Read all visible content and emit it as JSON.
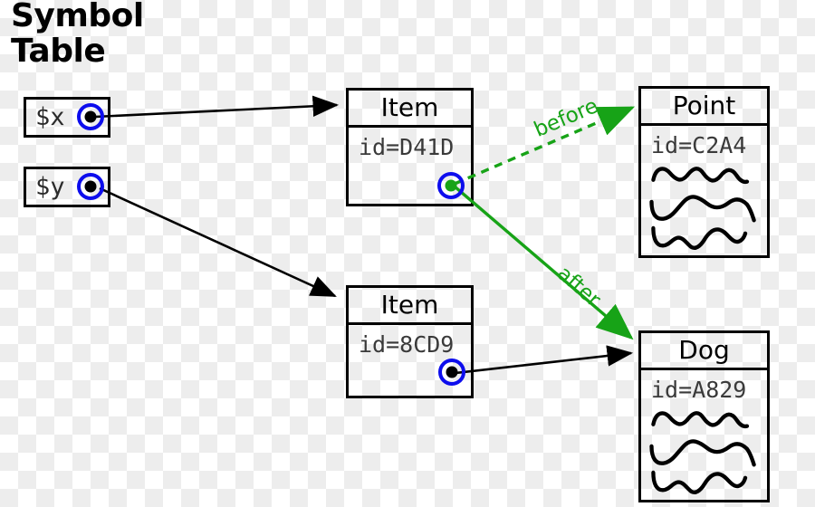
{
  "diagram": {
    "title_line1": "Symbol",
    "title_line2": "Table",
    "colors": {
      "ink": "#000000",
      "pointer_ring": "#0d0ded",
      "green": "#17a317",
      "id_text": "#3a3a3a",
      "background_check": "#ededed"
    }
  },
  "symbol_table": {
    "variables": [
      {
        "name": "$x",
        "pointer": "pointer-dot-black"
      },
      {
        "name": "$y",
        "pointer": "pointer-dot-black"
      }
    ]
  },
  "objects": [
    {
      "key": "item1",
      "class_name": "Item",
      "id_label": "id=D41D",
      "has_scribbles": false,
      "slot_pointer": "pointer-dot-green"
    },
    {
      "key": "item2",
      "class_name": "Item",
      "id_label": "id=8CD9",
      "has_scribbles": false,
      "slot_pointer": "pointer-dot-black"
    },
    {
      "key": "point",
      "class_name": "Point",
      "id_label": "id=C2A4",
      "has_scribbles": true,
      "slot_pointer": null
    },
    {
      "key": "dog",
      "class_name": "Dog",
      "id_label": "id=A829",
      "has_scribbles": true,
      "slot_pointer": null
    }
  ],
  "edges": [
    {
      "key": "x-to-item1",
      "from": "$x",
      "to": "Item (D41D)",
      "style": "solid",
      "color": "#000000",
      "label": ""
    },
    {
      "key": "y-to-item2",
      "from": "$y",
      "to": "Item (8CD9)",
      "style": "solid",
      "color": "#000000",
      "label": ""
    },
    {
      "key": "item1-to-point",
      "from": "Item (D41D)",
      "to": "Point (C2A4)",
      "style": "dashed",
      "color": "#17a317",
      "label": "before"
    },
    {
      "key": "item1-to-dog",
      "from": "Item (D41D)",
      "to": "Dog (A829)",
      "style": "solid",
      "color": "#17a317",
      "label": "after"
    },
    {
      "key": "item2-to-dog",
      "from": "Item (8CD9)",
      "to": "Dog (A829)",
      "style": "solid",
      "color": "#000000",
      "label": ""
    }
  ],
  "labels": {
    "before": "before",
    "after": "after"
  }
}
